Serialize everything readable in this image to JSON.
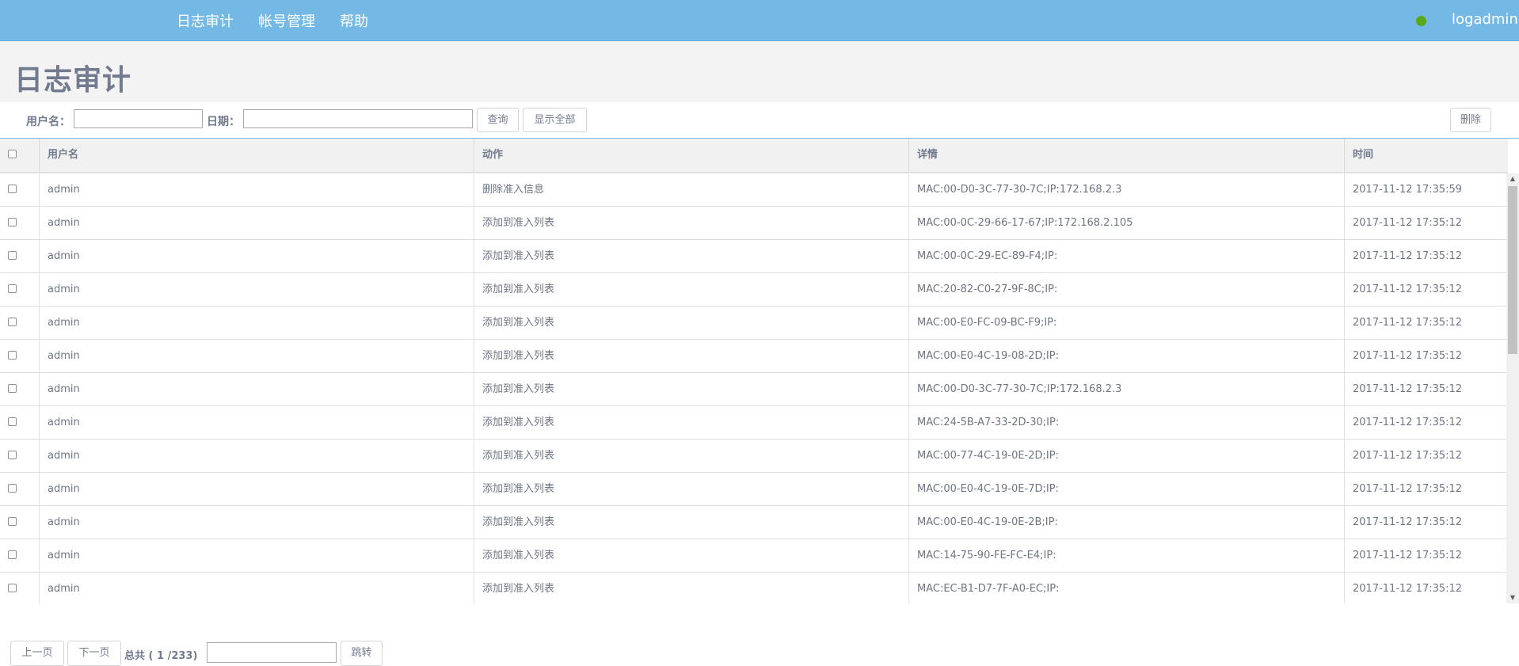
{
  "nav": {
    "items": [
      {
        "label": "日志审计"
      },
      {
        "label": "帐号管理"
      },
      {
        "label": "帮助"
      }
    ],
    "status_color": "#5aa91c",
    "user": "logadmin"
  },
  "page": {
    "title": "日志审计"
  },
  "toolbar": {
    "username_label": "用户名：",
    "username_value": "",
    "date_label": "日期：",
    "date_value": "",
    "query_button": "查询",
    "show_all_button": "显示全部",
    "delete_button": "删除"
  },
  "table": {
    "columns": [
      "用户名",
      "动作",
      "详情",
      "时间"
    ],
    "rows": [
      {
        "user": "admin",
        "action": "删除准入信息",
        "detail": "MAC:00-D0-3C-77-30-7C;IP:172.168.2.3",
        "time": "2017-11-12 17:35:59"
      },
      {
        "user": "admin",
        "action": "添加到准入列表",
        "detail": "MAC:00-0C-29-66-17-67;IP:172.168.2.105",
        "time": "2017-11-12 17:35:12"
      },
      {
        "user": "admin",
        "action": "添加到准入列表",
        "detail": "MAC:00-0C-29-EC-89-F4;IP:",
        "time": "2017-11-12 17:35:12"
      },
      {
        "user": "admin",
        "action": "添加到准入列表",
        "detail": "MAC:20-82-C0-27-9F-8C;IP:",
        "time": "2017-11-12 17:35:12"
      },
      {
        "user": "admin",
        "action": "添加到准入列表",
        "detail": "MAC:00-E0-FC-09-BC-F9;IP:",
        "time": "2017-11-12 17:35:12"
      },
      {
        "user": "admin",
        "action": "添加到准入列表",
        "detail": "MAC:00-E0-4C-19-08-2D;IP:",
        "time": "2017-11-12 17:35:12"
      },
      {
        "user": "admin",
        "action": "添加到准入列表",
        "detail": "MAC:00-D0-3C-77-30-7C;IP:172.168.2.3",
        "time": "2017-11-12 17:35:12"
      },
      {
        "user": "admin",
        "action": "添加到准入列表",
        "detail": "MAC:24-5B-A7-33-2D-30;IP:",
        "time": "2017-11-12 17:35:12"
      },
      {
        "user": "admin",
        "action": "添加到准入列表",
        "detail": "MAC:00-77-4C-19-0E-2D;IP:",
        "time": "2017-11-12 17:35:12"
      },
      {
        "user": "admin",
        "action": "添加到准入列表",
        "detail": "MAC:00-E0-4C-19-0E-7D;IP:",
        "time": "2017-11-12 17:35:12"
      },
      {
        "user": "admin",
        "action": "添加到准入列表",
        "detail": "MAC:00-E0-4C-19-0E-2B;IP:",
        "time": "2017-11-12 17:35:12"
      },
      {
        "user": "admin",
        "action": "添加到准入列表",
        "detail": "MAC:14-75-90-FE-FC-E4;IP:",
        "time": "2017-11-12 17:35:12"
      },
      {
        "user": "admin",
        "action": "添加到准入列表",
        "detail": "MAC:EC-B1-D7-7F-A0-EC;IP:",
        "time": "2017-11-12 17:35:12"
      }
    ]
  },
  "pager": {
    "prev_button": "上一页",
    "next_button": "下一页",
    "total_text": "总共 ( 1   /233)",
    "jump_value": "",
    "jump_button": "跳转"
  }
}
